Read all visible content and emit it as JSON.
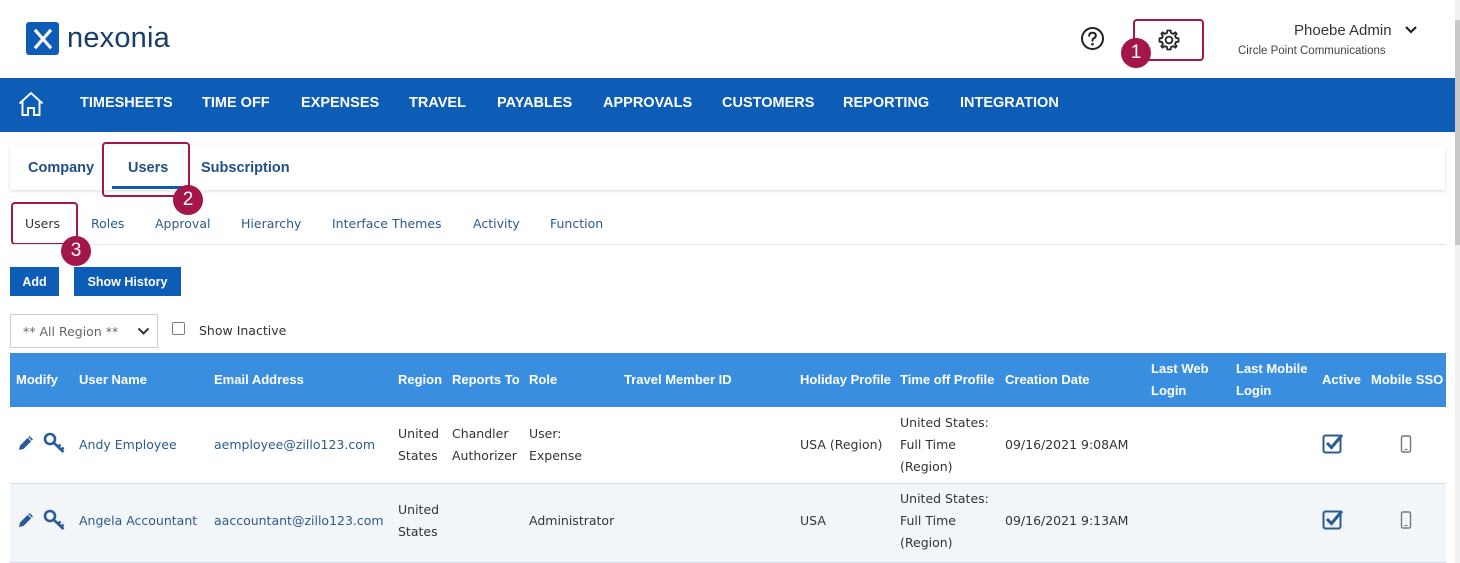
{
  "app": {
    "logo_text": "nexonia"
  },
  "header": {
    "user_name": "Phoebe Admin",
    "company_name": "Circle Point Communications"
  },
  "badges": [
    "1",
    "2",
    "3"
  ],
  "nav": {
    "items": [
      "TIMESHEETS",
      "TIME OFF",
      "EXPENSES",
      "TRAVEL",
      "PAYABLES",
      "APPROVALS",
      "CUSTOMERS",
      "REPORTING",
      "INTEGRATION"
    ]
  },
  "tabs": [
    "Company",
    "Users",
    "Subscription"
  ],
  "subtabs": [
    "Users",
    "Roles",
    "Approval",
    "Hierarchy",
    "Interface Themes",
    "Activity",
    "Function"
  ],
  "actions": {
    "add_label": "Add",
    "history_label": "Show History"
  },
  "filters": {
    "region_selected": "** All Region **",
    "show_inactive_label": "Show Inactive"
  },
  "table": {
    "headers": {
      "modify": "Modify",
      "user_name": "User Name",
      "email": "Email Address",
      "region": "Region",
      "reports_to": "Reports To",
      "role": "Role",
      "travel_member_id": "Travel Member ID",
      "holiday_profile": "Holiday Profile",
      "time_off_profile": "Time off Profile",
      "creation_date": "Creation Date",
      "last_web_login": [
        "Last Web",
        "Login"
      ],
      "last_mobile_login": [
        "Last Mobile",
        "Login"
      ],
      "active": "Active",
      "mobile_sso": "Mobile SSO"
    },
    "rows": [
      {
        "user_name": "Andy Employee",
        "email": "aemployee@zillo123.com",
        "region": [
          "United",
          "States"
        ],
        "reports_to": [
          "Chandler",
          "Authorizer"
        ],
        "role": [
          "User:",
          "Expense"
        ],
        "travel_member_id": "",
        "holiday_profile": "USA (Region)",
        "time_off_profile": [
          "United States:",
          "Full Time",
          "(Region)"
        ],
        "creation_date": "09/16/2021 9:08AM",
        "active": true
      },
      {
        "user_name": "Angela Accountant",
        "email": "aaccountant@zillo123.com",
        "region": [
          "United",
          "States"
        ],
        "reports_to": [],
        "role": [
          "Administrator"
        ],
        "travel_member_id": "",
        "holiday_profile": "USA",
        "time_off_profile": [
          "United States:",
          "Full Time",
          "(Region)"
        ],
        "creation_date": "09/16/2021 9:13AM",
        "active": true
      }
    ]
  },
  "colors": {
    "brand": "#0d5cb6",
    "table_header": "#3a8ee0",
    "callout": "#a4164a",
    "link": "#2d5a8c"
  },
  "icons": [
    "x-logo-icon",
    "help-icon",
    "gear-icon",
    "chevron-down-icon",
    "home-icon",
    "pencil-icon",
    "key-icon",
    "checkbox-checked-icon",
    "mobile-phone-icon"
  ]
}
